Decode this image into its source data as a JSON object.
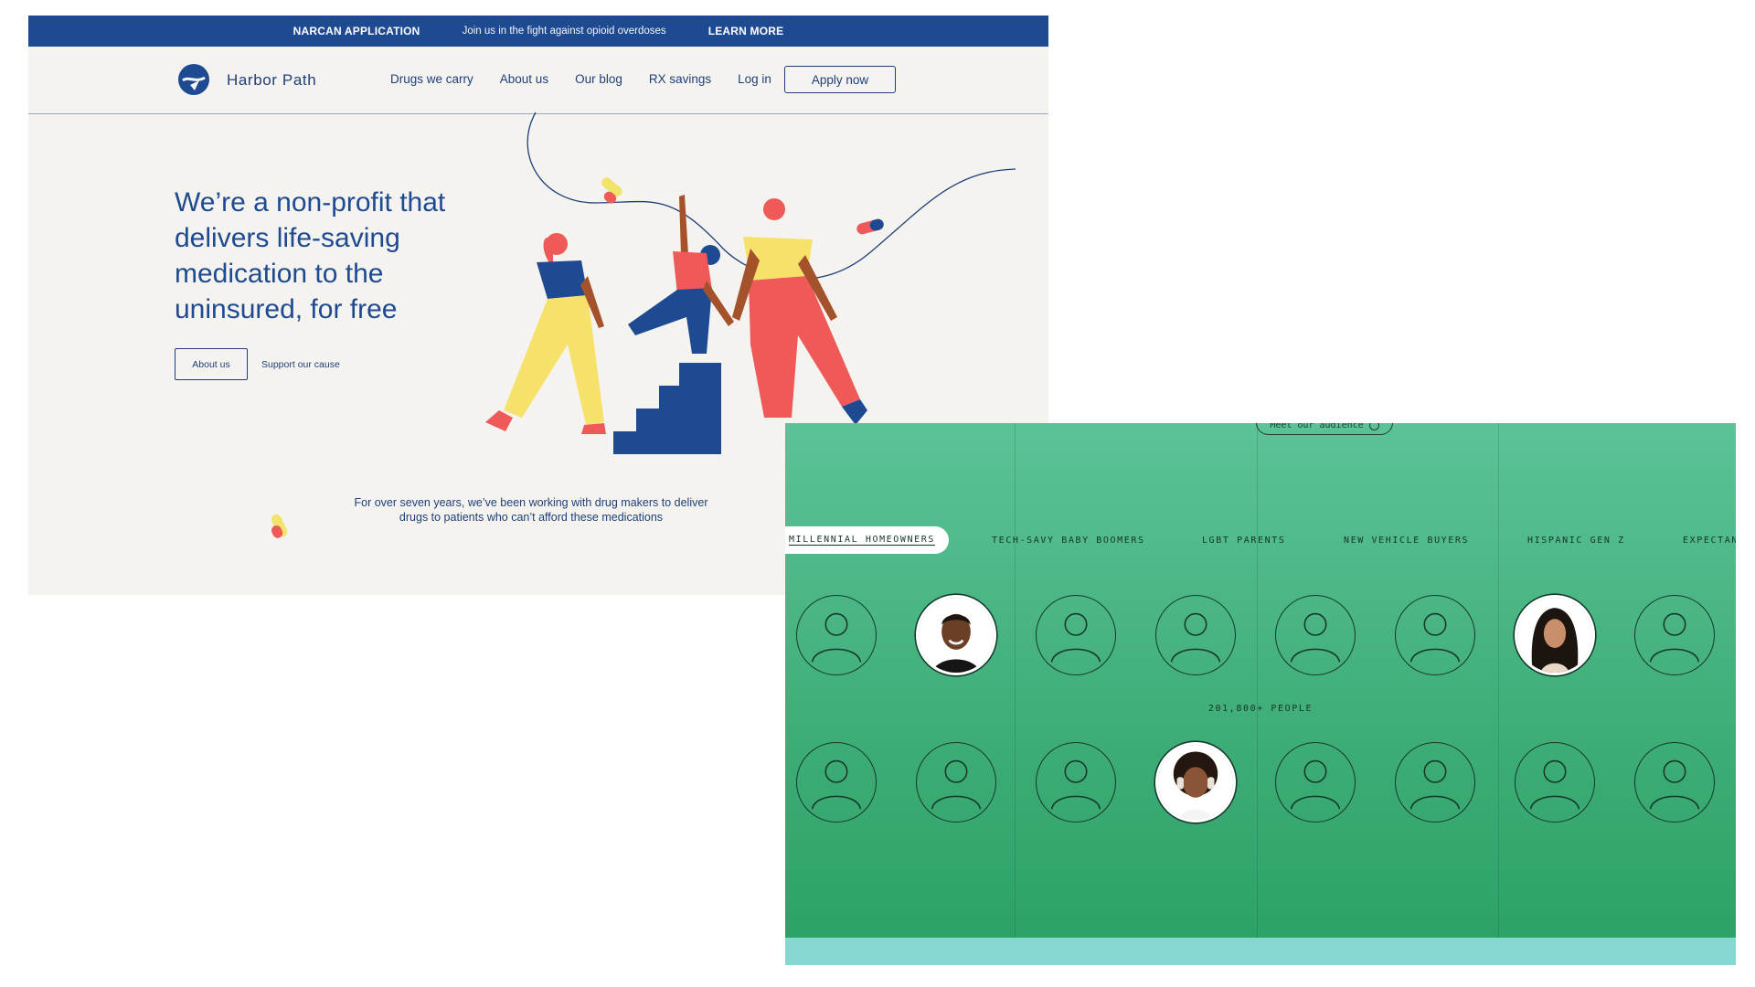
{
  "harbor": {
    "banner": {
      "left": "NARCAN APPLICATION",
      "middle": "Join us in the fight against opioid overdoses",
      "right": "LEARN MORE"
    },
    "brand": "Harbor Path",
    "nav": [
      "Drugs we carry",
      "About us",
      "Our blog",
      "RX savings",
      "Log in"
    ],
    "apply": "Apply now",
    "hero_title": "We’re a non-profit that delivers life-saving medication to the uninsured, for free",
    "about_btn": "About us",
    "support_link": "Support our cause",
    "sub_line1": "For over seven years, we’ve been working with drug makers to deliver",
    "sub_line2": "drugs to patients who can’t afford these medications"
  },
  "audience": {
    "meet_btn": "Meet our audience",
    "tabs": [
      "MILLENNIAL HOMEOWNERS",
      "TECH-SAVY BABY BOOMERS",
      "LGBT PARENTS",
      "NEW VEHICLE BUYERS",
      "HISPANIC GEN Z",
      "EXPECTAN"
    ],
    "active_tab": "MILLENNIAL HOMEOWNERS",
    "count_label": "201,800+ PEOPLE",
    "row1": [
      "placeholder",
      "photo-man",
      "placeholder",
      "placeholder",
      "placeholder",
      "placeholder",
      "photo-woman",
      "placeholder"
    ],
    "row2": [
      "placeholder",
      "placeholder",
      "placeholder",
      "photo-woman-headphones",
      "placeholder",
      "placeholder",
      "placeholder",
      "placeholder"
    ]
  },
  "colors": {
    "navy": "#1e4a92",
    "cream": "#f5f3ef",
    "green_top": "#5bc397",
    "green_bottom": "#2aa065",
    "teal_strip": "#86d6d2"
  }
}
